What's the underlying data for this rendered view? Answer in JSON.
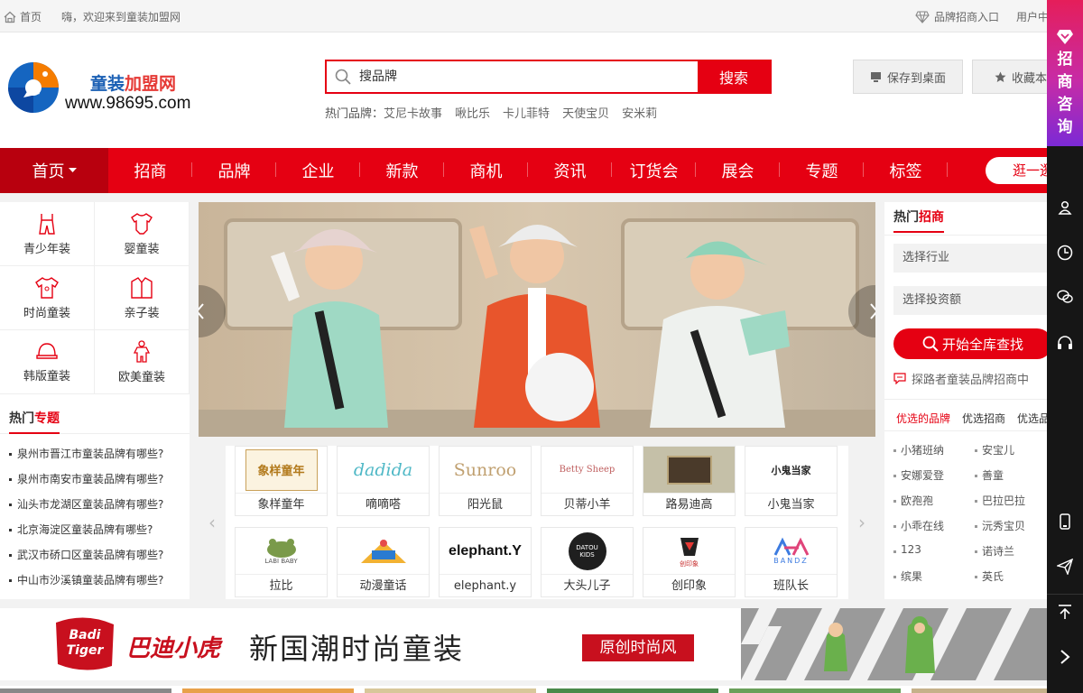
{
  "topbar": {
    "home_label": "首页",
    "welcome": "嗨，欢迎来到童装加盟网",
    "brand_entry": "品牌招商入口",
    "user_center": "用户中心"
  },
  "logo": {
    "name_blue": "童装",
    "name_red": "加盟网",
    "url": "www.98695.com"
  },
  "search": {
    "placeholder": "搜品牌",
    "button": "搜索"
  },
  "hot_brands": {
    "label": "热门品牌：",
    "items": [
      "艾尼卡故事",
      "啾比乐",
      "卡儿菲特",
      "天使宝贝",
      "安米莉"
    ]
  },
  "actions": {
    "save_desktop": "保存到桌面",
    "favorite": "收藏本站"
  },
  "nav": {
    "home": "首页",
    "items": [
      "招商",
      "品牌",
      "企业",
      "新款",
      "商机",
      "资讯",
      "订货会",
      "展会",
      "专题",
      "标签"
    ],
    "cta": "逛一逛"
  },
  "categories": [
    "青少年装",
    "婴童装",
    "时尚童装",
    "亲子装",
    "韩版童装",
    "欧美童装"
  ],
  "topics": {
    "title_a": "热门",
    "title_b": "专题",
    "items": [
      "泉州市晋江市童装品牌有哪些?",
      "泉州市南安市童装品牌有哪些?",
      "汕头市龙湖区童装品牌有哪些?",
      "北京海淀区童装品牌有哪些?",
      "武汉市硚口区童装品牌有哪些?",
      "中山市沙溪镇童装品牌有哪些?"
    ]
  },
  "brands": [
    {
      "name": "象样童年",
      "logo": "象样童年"
    },
    {
      "name": "嘀嘀嗒",
      "logo": "dadida"
    },
    {
      "name": "阳光鼠",
      "logo": "Sunroo"
    },
    {
      "name": "贝蒂小羊",
      "logo": "Betty Sheep"
    },
    {
      "name": "路易迪高",
      "logo": ""
    },
    {
      "name": "小鬼当家",
      "logo": "小鬼当家"
    },
    {
      "name": "拉比",
      "logo": "LABI BABY"
    },
    {
      "name": "动漫童话",
      "logo": ""
    },
    {
      "name": "elephant.y",
      "logo": "elephant.Y"
    },
    {
      "name": "大头儿子",
      "logo": "DATOU KIDS"
    },
    {
      "name": "创印象",
      "logo": "创印象"
    },
    {
      "name": "班队长",
      "logo": "BANDZ"
    }
  ],
  "recruit": {
    "title_a": "热门",
    "title_b": "招商",
    "industry": "选择行业",
    "investment": "选择投资额",
    "find_button": "开始全库查找",
    "note": "探路者童装品牌招商中",
    "tabs": [
      "优选的品牌",
      "优选招商",
      "优选品牌"
    ],
    "brand_list": [
      "小猪班纳",
      "安宝儿",
      "安娜爱登",
      "善童",
      "欧孢孢",
      "巴拉巴拉",
      "小乖在线",
      "沅秀宝贝",
      "123",
      "诺诗兰",
      "缤果",
      "英氏"
    ]
  },
  "ad": {
    "logo_en": "Badi Tiger",
    "logo_cn": "巴迪小虎",
    "slogan": "新国潮时尚童装",
    "tag": "原创时尚风"
  },
  "sidebar": {
    "consult": "招商咨询",
    "icons": [
      "user-icon",
      "clock-icon",
      "chat-icon",
      "headset-icon",
      "mobile-icon",
      "send-icon",
      "back-to-top-icon",
      "expand-icon"
    ]
  },
  "colors": {
    "brand_red": "#e50012",
    "nav_active": "#b8000e",
    "sidebar": "#161616"
  }
}
